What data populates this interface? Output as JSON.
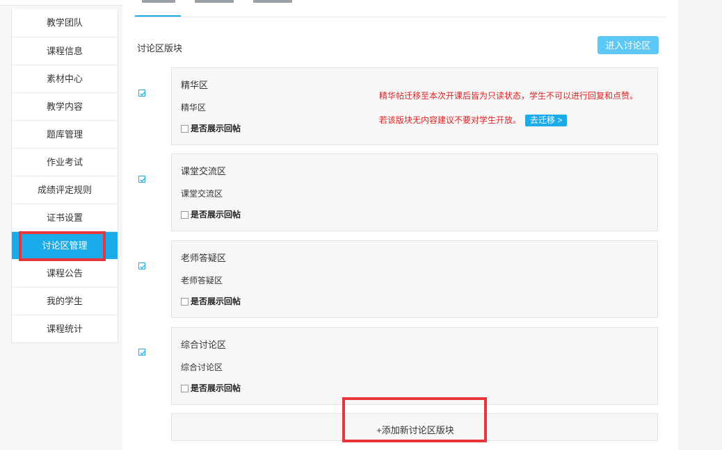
{
  "sidebar": {
    "items": [
      {
        "label": "教学团队",
        "active": false
      },
      {
        "label": "课程信息",
        "active": false
      },
      {
        "label": "素材中心",
        "active": false
      },
      {
        "label": "教学内容",
        "active": false
      },
      {
        "label": "题库管理",
        "active": false
      },
      {
        "label": "作业考试",
        "active": false
      },
      {
        "label": "成绩评定规则",
        "active": false
      },
      {
        "label": "证书设置",
        "active": false
      },
      {
        "label": "讨论区管理",
        "active": true
      },
      {
        "label": "课程公告",
        "active": false
      },
      {
        "label": "我的学生",
        "active": false
      },
      {
        "label": "课程统计",
        "active": false
      }
    ]
  },
  "main": {
    "section_title": "讨论区版块",
    "enter_button": "进入讨论区",
    "show_replies_label": "是否展示回帖",
    "blocks": [
      {
        "title": "精华区",
        "desc": "精华区",
        "checked": true,
        "show_replies": false
      },
      {
        "title": "课堂交流区",
        "desc": "课堂交流区",
        "checked": true,
        "show_replies": false
      },
      {
        "title": "老师答疑区",
        "desc": "老师答疑区",
        "checked": true,
        "show_replies": false
      },
      {
        "title": "综合讨论区",
        "desc": "综合讨论区",
        "checked": true,
        "show_replies": false
      }
    ],
    "warning_line1": "精华帖迁移至本次开课后皆为只读状态，学生不可以进行回复和点赞。",
    "warning_line2": "若该版块无内容建议不要对学生开放。",
    "migrate_button": "去迁移 >",
    "add_block": "+添加新讨论区版块"
  },
  "colors": {
    "accent": "#1aabea",
    "warning": "#e02020",
    "highlight_box": "#e8353b"
  }
}
